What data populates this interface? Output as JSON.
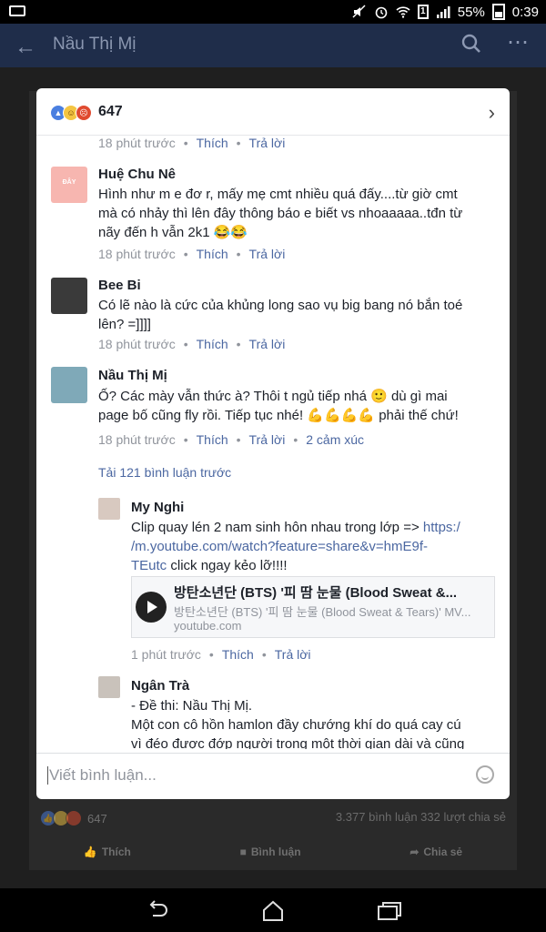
{
  "status_bar": {
    "battery": "55%",
    "time": "0:39",
    "sim": "1"
  },
  "app_bar": {
    "title": "Nầu Thị Mị"
  },
  "modal": {
    "reaction_count": "647",
    "comments": [
      {
        "time": "18 phút trước",
        "like": "Thích",
        "reply": "Trả lời"
      },
      {
        "name": "Huệ Chu Nê",
        "text": [
          "Hình như m e đơ r, mấy mẹ cmt nhiều quá đấy....từ giờ cmt",
          "mà có nhảy thì lên đây thông báo e biết vs nhoaaaaa..tđn từ",
          "nãy đến h vẫn 2k1 😂😂"
        ],
        "avatar_text": "ĐÂY",
        "time": "18 phút trước",
        "like": "Thích",
        "reply": "Trả lời"
      },
      {
        "name": "Bee Bi",
        "text": [
          "Có lẽ nào là cức của khủng long sao vụ big bang nó bắn toé",
          "lên? =]]]]"
        ],
        "time": "18 phút trước",
        "like": "Thích",
        "reply": "Trả lời"
      },
      {
        "name": "Nầu Thị Mị",
        "text": [
          "Ố? Các mày vẫn thức à? Thôi t ngủ tiếp nhá 🙂 dù gì mai",
          "page bố cũng fly rồi. Tiếp tục nhé! 💪💪💪💪 phải thế chứ!"
        ],
        "time": "18 phút trước",
        "like": "Thích",
        "reply": "Trả lời",
        "reactions": "2 cảm xúc"
      }
    ],
    "load_previous": "Tải 121 bình luận trước",
    "replies": [
      {
        "name": "My Nghi",
        "text_plain": "Clip quay lén 2 nam sinh hôn nhau trong lớp =>",
        "url_part1": "https:/",
        "url_part2": "/m.youtube.com/watch?feature=share&v=hmE9f-",
        "url_part3": "TEutc",
        "text_after": "click ngay kẻo lỡ!!!!",
        "link_title": "방탄소년단 (BTS) '피 땀 눈물 (Blood Sweat &...",
        "link_desc": "방탄소년단 (BTS) '피 땀 눈물 (Blood Sweat & Tears)' MV...",
        "link_domain": "youtube.com",
        "time": "1 phút trước",
        "like": "Thích",
        "reply": "Trả lời"
      },
      {
        "name": "Ngân Trà",
        "text": [
          "- Đề thi: Nầu Thị Mị.",
          "Một con cô hồn hamlon đầy chướng khí do quá cay cú",
          "vì đéo được đớp người trong một thời gian dài và cũng"
        ]
      }
    ],
    "input_placeholder": "Viết bình luận..."
  },
  "background": {
    "reaction_count": "647",
    "comment_share": "3.377 bình luận 332 lượt chia sẻ",
    "like": "Thích",
    "comment": "Bình luận",
    "share": "Chia sẻ"
  },
  "colors": {
    "accent": "#4b67a1",
    "appbar": "#1f2d4a",
    "overlay": "#1f1f1f"
  }
}
